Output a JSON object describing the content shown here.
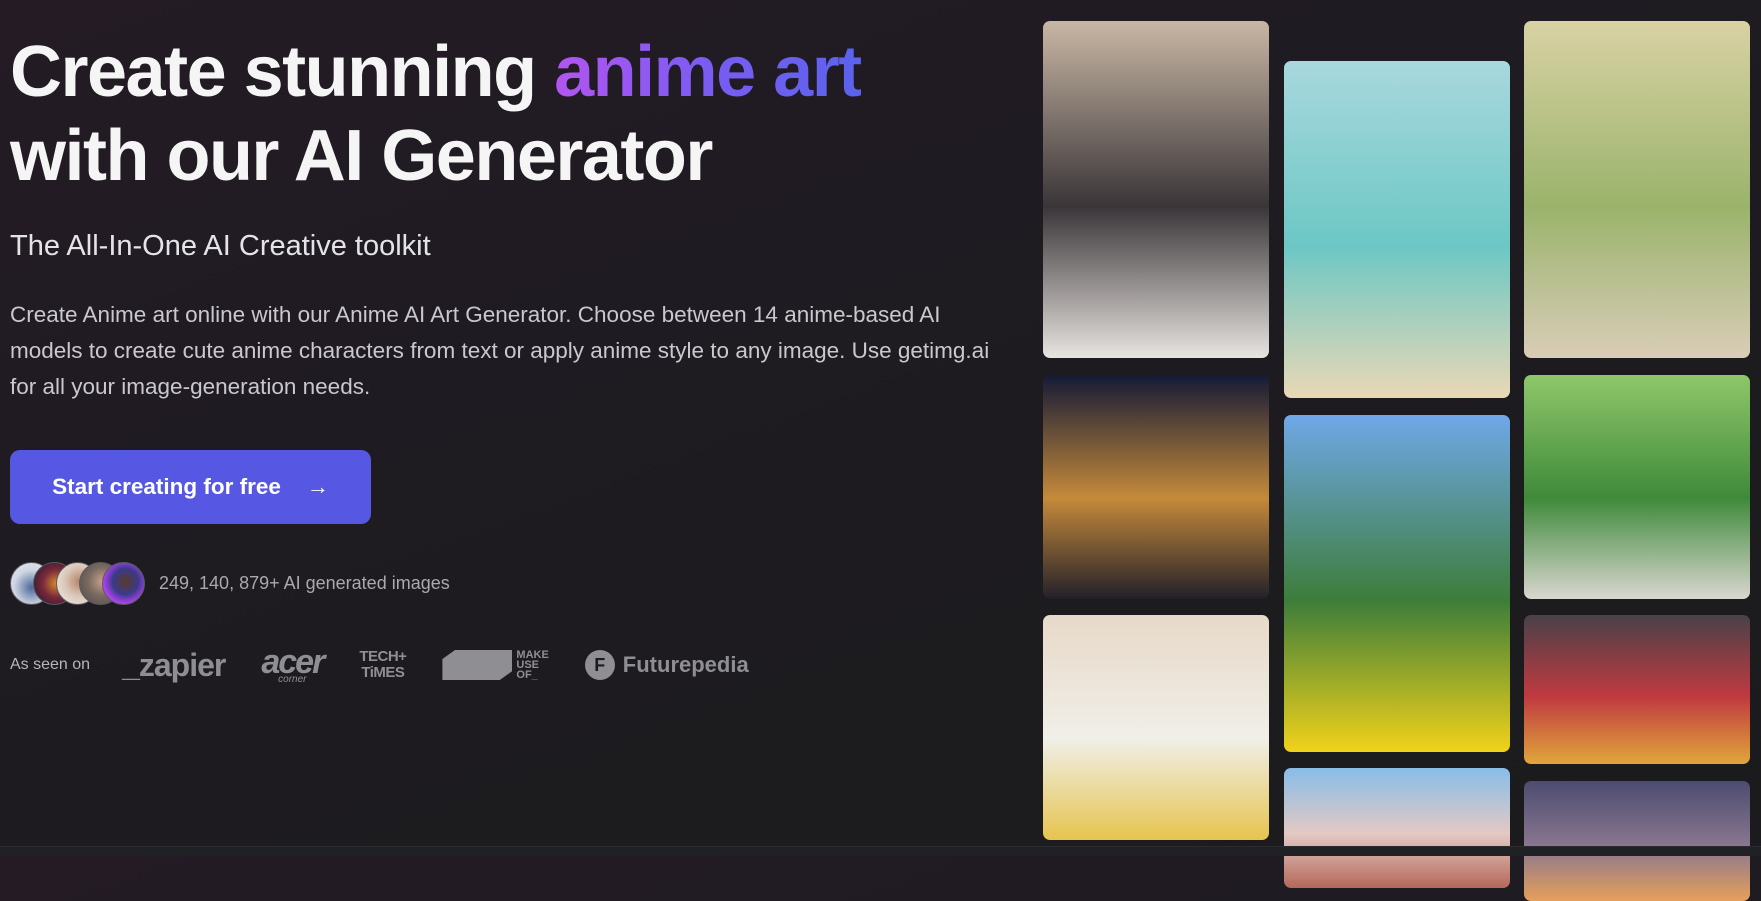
{
  "hero": {
    "title_part1": "Create stunning ",
    "title_highlight": "anime art",
    "title_part2": "with our AI Generator",
    "subtitle": "The All-In-One AI Creative toolkit",
    "description": "Create Anime art online with our Anime AI Art Generator. Choose between 14 anime-based AI models to create cute anime characters from text or apply anime style to any image. Use getimg.ai for all your image-generation needs.",
    "cta_label": "Start creating for free",
    "cta_icon": "arrow-right-icon"
  },
  "social_proof": {
    "avatars": [
      "avatar-1",
      "avatar-2",
      "avatar-3",
      "avatar-4",
      "avatar-5"
    ],
    "text": "249, 140, 879+ AI generated images"
  },
  "as_seen_on": {
    "label": "As seen on",
    "logos": {
      "zapier": "_zapier",
      "acer_main": "acer",
      "acer_sub": "corner",
      "tech_line1": "TECH+",
      "tech_line2": "TiMES",
      "muo_line1": "MAKE",
      "muo_line2": "USE",
      "muo_line3": "OF_",
      "futurepedia_icon": "F",
      "futurepedia": "Futurepedia"
    }
  },
  "gallery": {
    "images": [
      {
        "name": "girl-city-street-beret",
        "colors": [
          "#c9b7a5",
          "#3a3538",
          "#e8e4e0"
        ]
      },
      {
        "name": "girl-night-city-rooftop",
        "colors": [
          "#141a36",
          "#c58a3a",
          "#23202a"
        ]
      },
      {
        "name": "girl-supermarket-aisle",
        "colors": [
          "#e7d9c8",
          "#f0efe8",
          "#e6c44f"
        ]
      },
      {
        "name": "girl-jumping-beach",
        "colors": [
          "#a8d8de",
          "#6cc7c4",
          "#e9d8b6"
        ]
      },
      {
        "name": "girl-racer-yellow-car",
        "colors": [
          "#6fa8e8",
          "#3d7d3a",
          "#f1d21a"
        ]
      },
      {
        "name": "cat-girl-fantasy-city",
        "colors": [
          "#88bde8",
          "#e3c9c4",
          "#b5685a"
        ]
      },
      {
        "name": "boy-park-bench",
        "colors": [
          "#d9d2a4",
          "#9ab36b",
          "#d9cdb8"
        ]
      },
      {
        "name": "couple-walking-park",
        "colors": [
          "#8fc76a",
          "#3f8a3a",
          "#d9d6d0"
        ]
      },
      {
        "name": "boy-umbrella-rain",
        "colors": [
          "#4a4148",
          "#c03a40",
          "#e0a63a"
        ]
      },
      {
        "name": "clock-tower-sunset",
        "colors": [
          "#4c4c70",
          "#8a7790",
          "#e5a05a"
        ]
      }
    ]
  }
}
